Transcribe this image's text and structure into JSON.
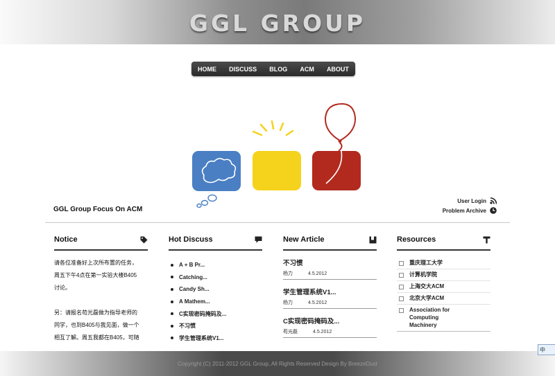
{
  "header": {
    "logo": "GGL GROUP"
  },
  "nav": [
    "HOME",
    "DISCUSS",
    "BLOG",
    "ACM",
    "ABOUT"
  ],
  "tagline": "GGL Group Focus On ACM",
  "links": {
    "login": "User Login",
    "archive": "Problem Archive"
  },
  "notice": {
    "title": "Notice",
    "lines": [
      "请各位准备好上次所布置的任务，",
      "周五下午4点在第一实验大楼B405",
      "讨论。",
      "",
      "另：请报名苟光磊做为指导老师的",
      "同学，也到B405与我见面，做一个",
      "相互了解。周五我都在B405，可随"
    ]
  },
  "hot": {
    "title": "Hot  Discuss",
    "items": [
      "A + B Pr...",
      "Catching...",
      "Candy Sh...",
      "A Mathem...",
      "C实现密码掩码及...",
      "不习惯",
      "学生管理系统V1..."
    ]
  },
  "articles": {
    "title": "New  Article",
    "items": [
      {
        "title": "不习惯",
        "author": "杨力",
        "date": "4.5.2012"
      },
      {
        "title": "学生管理系统V1...",
        "author": "杨力",
        "date": "4.5.2012"
      },
      {
        "title": "C实现密码掩码及...",
        "author": "苟光磊",
        "date": "4.5.2012"
      }
    ]
  },
  "resources": {
    "title": "Resources",
    "items": [
      "重庆理工大学",
      "计算机学院",
      "上海交大ACM",
      "北京大学ACM",
      "Association for Computing Machinery"
    ]
  },
  "footer": "Copyright (C) 2011-2012  GGL Group, All Rights Reserved   Design By  BreezeDust",
  "widget": "中",
  "colors": {
    "blue": "#4a7fc4",
    "yellow": "#f5d21c",
    "red": "#b22a1e"
  }
}
